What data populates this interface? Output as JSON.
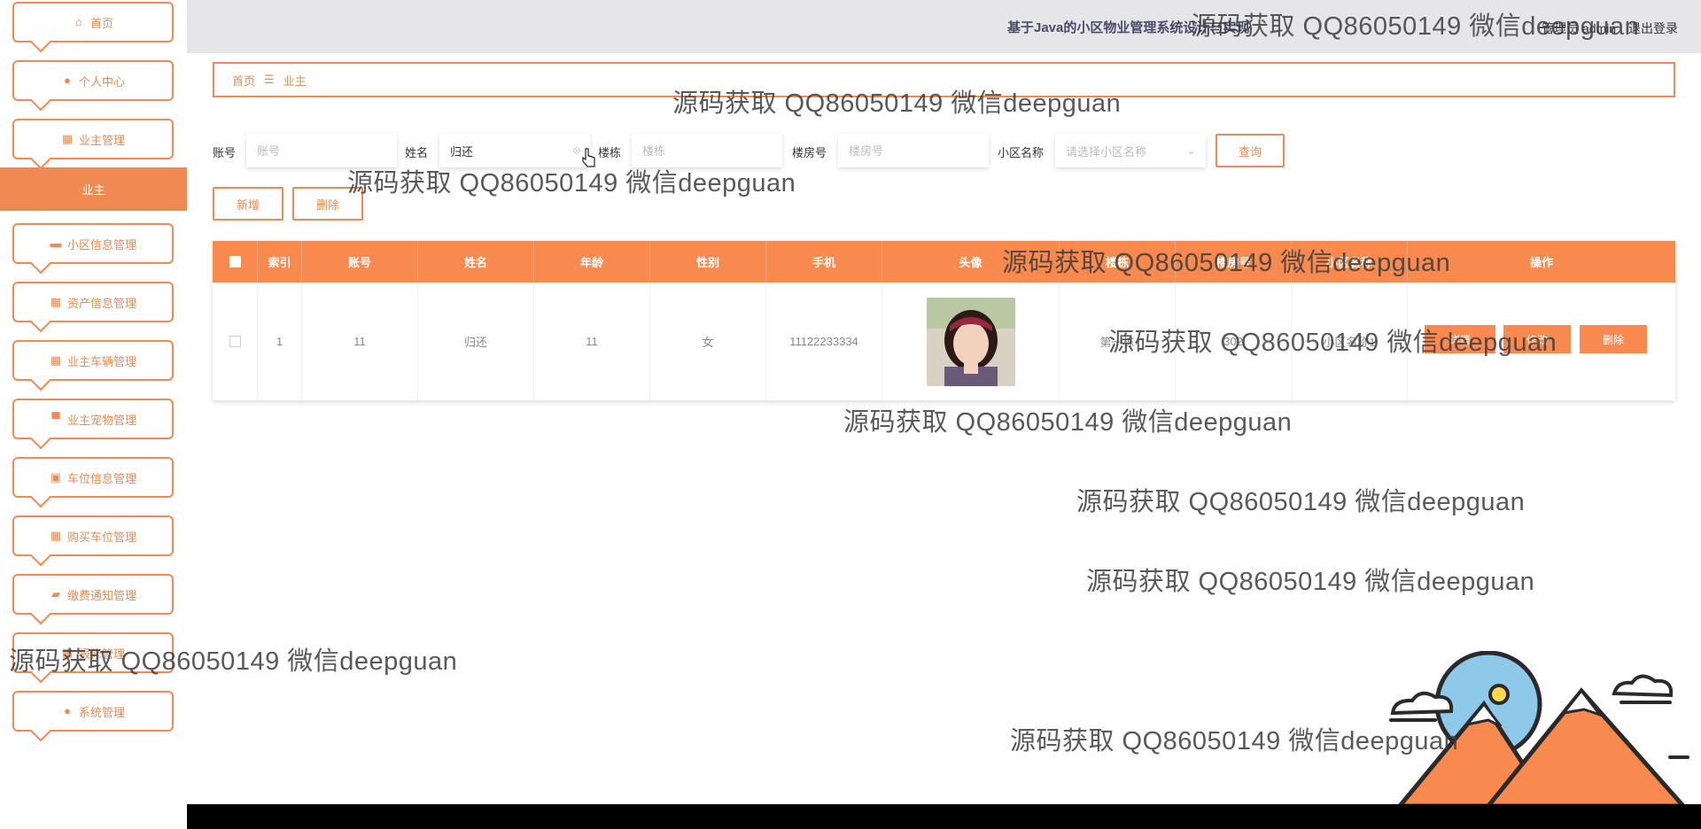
{
  "header": {
    "title": "基于Java的小区物业管理系统设计与实现",
    "user_role": "管理员 admin",
    "logout": "退出登录"
  },
  "sidebar": {
    "items": [
      {
        "label": "首页",
        "icon": "home-icon"
      },
      {
        "label": "个人中心",
        "icon": "user-icon"
      },
      {
        "label": "业主管理",
        "icon": "grid-icon"
      },
      {
        "label": "小区信息管理",
        "icon": "briefcase-icon"
      },
      {
        "label": "资产信息管理",
        "icon": "grid-icon"
      },
      {
        "label": "业主车辆管理",
        "icon": "grid-icon"
      },
      {
        "label": "业主宠物管理",
        "icon": "monitor-icon"
      },
      {
        "label": "车位信息管理",
        "icon": "clipboard-icon"
      },
      {
        "label": "购买车位管理",
        "icon": "grid-icon"
      },
      {
        "label": "缴费通知管理",
        "icon": "wallet-icon"
      },
      {
        "label": "报修管理",
        "icon": "grid-icon"
      },
      {
        "label": "系统管理",
        "icon": "user-icon"
      }
    ],
    "active_subitem": "业主"
  },
  "breadcrumb": {
    "home": "首页",
    "separator": "☰",
    "current": "业主"
  },
  "filters": {
    "account_label": "账号",
    "account_placeholder": "账号",
    "name_label": "姓名",
    "name_value": "归还",
    "building_label": "楼栋",
    "building_placeholder": "楼栋",
    "room_label": "楼房号",
    "room_placeholder": "楼房号",
    "community_label": "小区名称",
    "community_placeholder": "请选择小区名称",
    "search_button": "查询"
  },
  "actions": {
    "add": "新增",
    "delete": "删除"
  },
  "table": {
    "columns": [
      "索引",
      "账号",
      "姓名",
      "年龄",
      "性别",
      "手机",
      "头像",
      "楼栋",
      "楼房号",
      "小区名称",
      "操作"
    ],
    "rows": [
      {
        "index": "1",
        "account": "11",
        "name": "归还",
        "age": "11",
        "gender": "女",
        "phone": "11122233334",
        "building": "第一栋",
        "room": "302",
        "community": "小区名称1",
        "ops": [
          "详情",
          "修改",
          "删除"
        ]
      }
    ]
  },
  "watermark_text": "源码获取 QQ86050149 微信deepguan",
  "colors": {
    "accent": "#f08a52",
    "header_bg": "#e6e6e8",
    "table_header": "#f8894f"
  }
}
